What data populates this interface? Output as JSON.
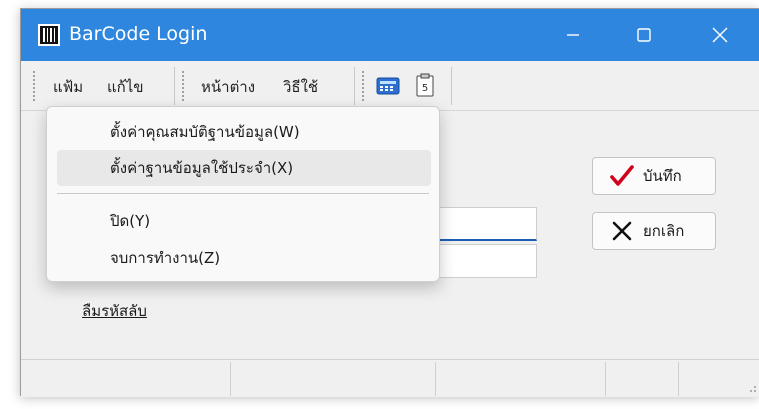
{
  "window": {
    "title": "BarCode Login",
    "accent_color": "#2e86de",
    "controls": [
      "minimize-icon",
      "maximize-icon",
      "close-icon"
    ]
  },
  "menubar": {
    "items": [
      {
        "label": "แฟ้ม",
        "open": true
      },
      {
        "label": "แก้ไข"
      },
      {
        "label": "หน้าต่าง"
      },
      {
        "label": "วิธีใช้"
      }
    ],
    "toolbar_icons": [
      "calculator-icon",
      "calendar-icon"
    ]
  },
  "file_menu": {
    "items": [
      {
        "label": "ตั้งค่าคุณสมบัติฐานข้อมูล(W)",
        "highlighted": false
      },
      {
        "label": "ตั้งค่าฐานข้อมูลใช้ประจำ(X)",
        "highlighted": true
      },
      {
        "label": "ปิด(Y)",
        "highlighted": false
      },
      {
        "label": "จบการทำงาน(Z)",
        "highlighted": false
      }
    ]
  },
  "form": {
    "username_value": "",
    "password_value": "",
    "save_label": "บันทึก",
    "save_icon": "checkmark-icon",
    "save_icon_color": "#d0021b",
    "cancel_label": "ยกเลิก",
    "cancel_icon": "x-icon",
    "forgot_password_label": "ลืมรหัสลับ"
  }
}
